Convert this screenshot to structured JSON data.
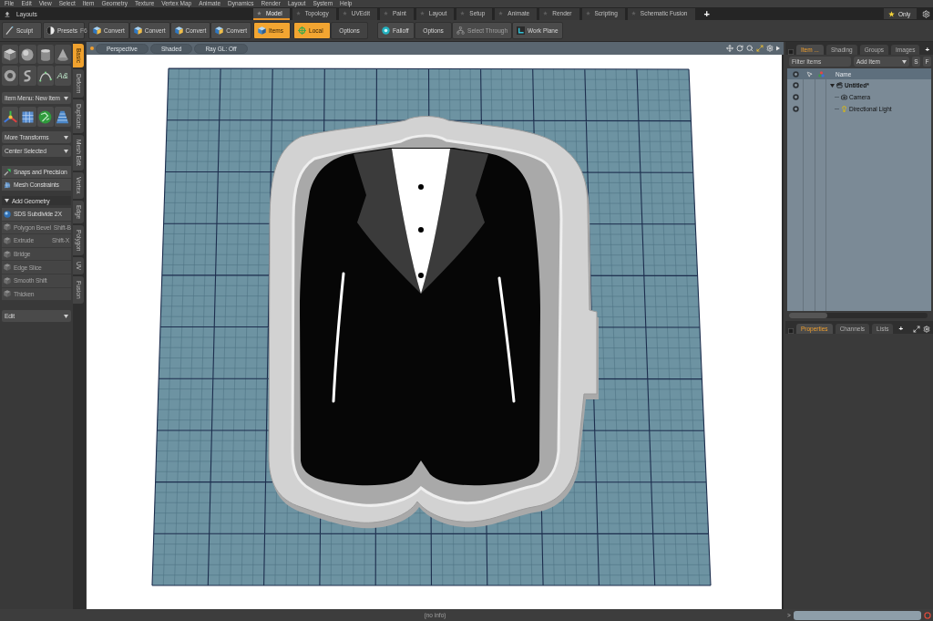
{
  "menu_bar": [
    "File",
    "Edit",
    "View",
    "Select",
    "Item",
    "Geometry",
    "Texture",
    "Vertex Map",
    "Animate",
    "Dynamics",
    "Render",
    "Layout",
    "System",
    "Help"
  ],
  "layouts_bar": {
    "title": "Layouts",
    "tabs": [
      {
        "label": "Model",
        "selected": true
      },
      {
        "label": "Topology",
        "selected": false
      },
      {
        "label": "UVEdit",
        "selected": false
      },
      {
        "label": "Paint",
        "selected": false
      },
      {
        "label": "Layout",
        "selected": false
      },
      {
        "label": "Setup",
        "selected": false
      },
      {
        "label": "Animate",
        "selected": false
      },
      {
        "label": "Render",
        "selected": false
      },
      {
        "label": "Scripting",
        "selected": false
      },
      {
        "label": "Schematic Fusion",
        "selected": false
      }
    ],
    "add_tab": "+",
    "filter": "Only"
  },
  "toolbar": {
    "sculpt": "Sculpt",
    "presets": {
      "label": "Presets",
      "shortcut": "F6"
    },
    "buttons": [
      {
        "label": "Convert",
        "kind": "convert",
        "active": false,
        "disabled": false
      },
      {
        "label": "Convert",
        "kind": "convert",
        "active": false,
        "disabled": false
      },
      {
        "label": "Convert",
        "kind": "convert",
        "active": false,
        "disabled": false
      },
      {
        "label": "Convert",
        "kind": "convert",
        "active": false,
        "disabled": false
      },
      {
        "label": "Items",
        "kind": "items",
        "active": true,
        "disabled": false
      },
      {
        "label": "Local",
        "kind": "local",
        "active": true,
        "disabled": false
      },
      {
        "label": "Options",
        "kind": "plain",
        "active": false,
        "disabled": false
      },
      {
        "label": "Falloff",
        "kind": "falloff",
        "active": false,
        "disabled": false
      },
      {
        "label": "Options",
        "kind": "plain",
        "active": false,
        "disabled": false
      },
      {
        "label": "Select Through",
        "kind": "select_through",
        "active": false,
        "disabled": true
      },
      {
        "label": "Work Plane",
        "kind": "work_plane",
        "active": false,
        "disabled": false
      }
    ]
  },
  "left_panel": {
    "text_tool": "A&",
    "item_menu": "Item Menu: New Item",
    "transform_menus": [
      "More Transforms",
      "Center Selected"
    ],
    "snapping": [
      "Snaps and Precision",
      "Mesh Constraints"
    ],
    "add_geometry": {
      "title": "Add Geometry",
      "expanded": true,
      "tools": [
        {
          "label": "SDS Subdivide 2X",
          "disabled": false
        },
        {
          "label": "Polygon Bevel",
          "shortcut": "Shift-B",
          "disabled": true
        },
        {
          "label": "Extrude",
          "shortcut": "Shift-X",
          "disabled": true
        },
        {
          "label": "Bridge",
          "disabled": true
        },
        {
          "label": "Edge Slice",
          "disabled": true
        },
        {
          "label": "Smooth Shift",
          "disabled": true
        },
        {
          "label": "Thicken",
          "disabled": true
        }
      ]
    },
    "edit_menu": "Edit"
  },
  "side_tabs": [
    {
      "label": "Basic",
      "selected": true
    },
    {
      "label": "Deform",
      "selected": false
    },
    {
      "label": "Duplicate",
      "selected": false
    },
    {
      "label": "Mesh Edit",
      "selected": false
    },
    {
      "label": "Vertex",
      "selected": false
    },
    {
      "label": "Edge",
      "selected": false
    },
    {
      "label": "Polygon",
      "selected": false
    },
    {
      "label": "UV",
      "selected": false
    },
    {
      "label": "Fusion",
      "selected": false
    }
  ],
  "viewport": {
    "buttons": [
      "Perspective",
      "Shaded",
      "Ray GL: Off"
    ]
  },
  "items_panel": {
    "tabs": [
      {
        "label": "Item ...",
        "selected": true
      },
      {
        "label": "Shading",
        "selected": false
      },
      {
        "label": "Groups",
        "selected": false
      },
      {
        "label": "Images",
        "selected": false
      }
    ],
    "add_tab": "+",
    "filter": {
      "placeholder": "Filter Items"
    },
    "add_item": "Add Item",
    "toggles": [
      "S",
      "F"
    ],
    "column": "Name",
    "tree": [
      {
        "label": "Untitled*",
        "kind": "scene",
        "expanded": true,
        "children": [
          {
            "label": "Camera",
            "kind": "camera"
          },
          {
            "label": "Directional Light",
            "kind": "light"
          }
        ]
      }
    ]
  },
  "properties_panel": {
    "tabs": [
      {
        "label": "Properties",
        "selected": true
      },
      {
        "label": "Channels",
        "selected": false
      },
      {
        "label": "Lists",
        "selected": false
      }
    ],
    "add_tab": "+"
  },
  "status_bar": {
    "info": "(no info)",
    "prompt": ">"
  }
}
